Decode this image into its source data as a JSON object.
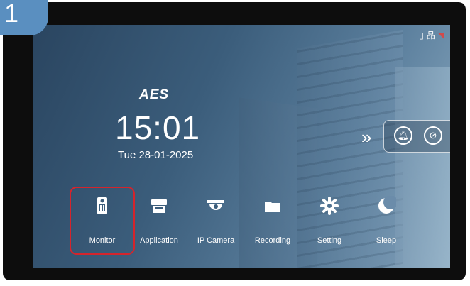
{
  "step_badge": "1",
  "status_bar": {
    "icons": [
      "sd-card-icon",
      "network-icon",
      "wifi-icon"
    ]
  },
  "home": {
    "logo": "AES",
    "time": "15:01",
    "date": "Tue 28-01-2025"
  },
  "quick_panel": {
    "expand_icon": "chevron-double-right-icon",
    "buttons": [
      "bell-icon",
      "do-not-disturb-icon"
    ]
  },
  "menu": {
    "selected": "Monitor",
    "items": [
      {
        "label": "Monitor",
        "icon": "intercom-icon"
      },
      {
        "label": "Application",
        "icon": "store-icon"
      },
      {
        "label": "IP Camera",
        "icon": "dome-camera-icon"
      },
      {
        "label": "Recording",
        "icon": "folder-icon"
      },
      {
        "label": "Setting",
        "icon": "gear-icon"
      },
      {
        "label": "Sleep",
        "icon": "moon-icon"
      }
    ]
  },
  "colors": {
    "highlight": "#d5242c",
    "badge": "#5a8fc0",
    "screen_bg": "#3b5d7b"
  }
}
